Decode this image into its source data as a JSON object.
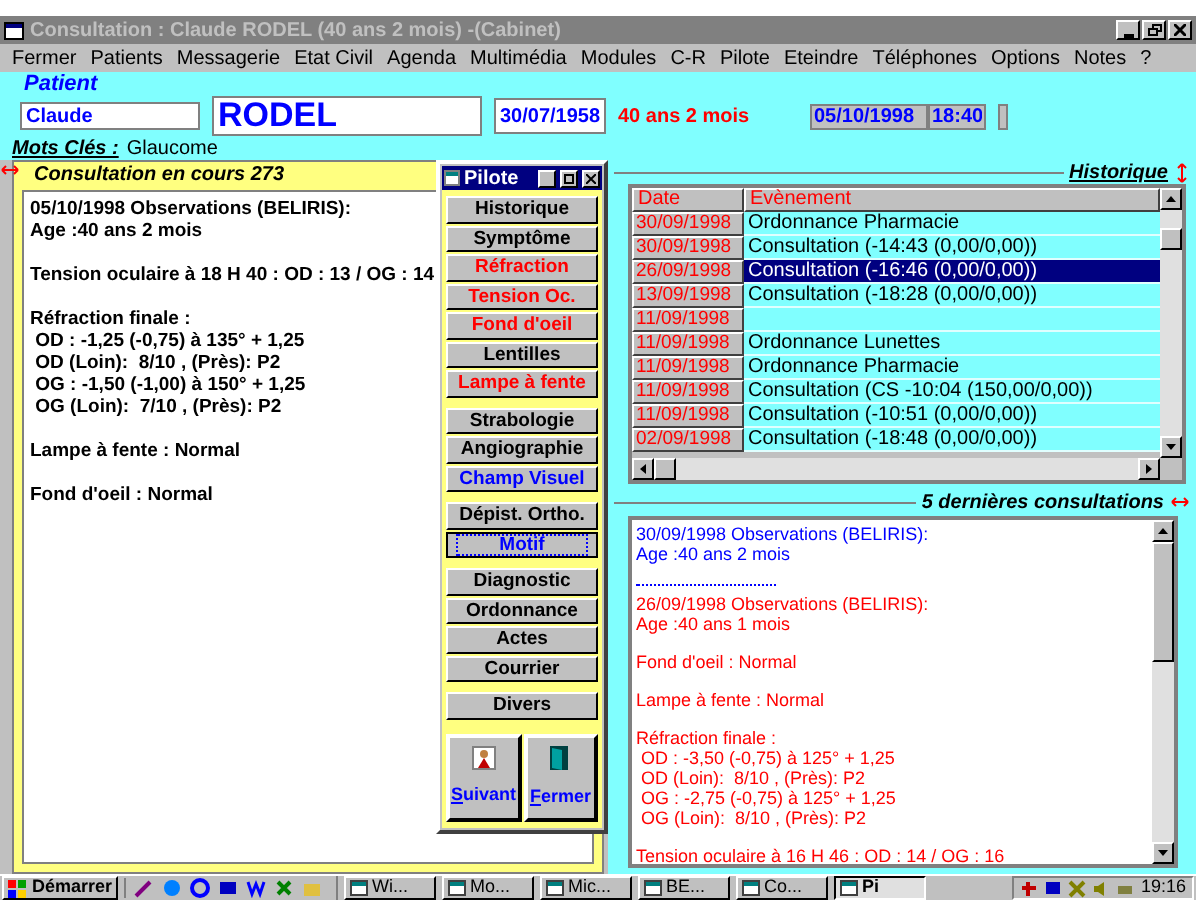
{
  "window": {
    "title": "Consultation : Claude RODEL (40 ans 2 mois)  -(Cabinet)"
  },
  "menu": [
    "Fermer",
    "Patients",
    "Messagerie",
    "Etat Civil",
    "Agenda",
    "Multimédia",
    "Modules",
    "C-R",
    "Pilote",
    "Eteindre",
    "Téléphones",
    "Options",
    "Notes",
    "?"
  ],
  "patient": {
    "label": "Patient",
    "first_name": "Claude",
    "last_name": "RODEL",
    "birth_date": "30/07/1958",
    "age": "40 ans 2 mois",
    "date": "05/10/1998",
    "time": "18:40",
    "keywords_label": "Mots Clés :",
    "keywords": "Glaucome"
  },
  "consultation": {
    "title": "Consultation en cours 273",
    "paragraphs": [
      [
        "05/10/1998 Observations (BELIRIS):",
        "Age :40 ans 2 mois"
      ],
      [
        "Tension oculaire à 18 H 40 : OD : 13 / OG : 14"
      ],
      [
        "Réfraction finale :",
        " OD : -1,25 (-0,75) à 135° + 1,25",
        " OD (Loin):  8/10 , (Près): P2",
        " OG : -1,50 (-1,00) à 150° + 1,25",
        " OG (Loin):  7/10 , (Près): P2"
      ],
      [
        "Lampe à fente : Normal"
      ],
      [
        "Fond d'oeil : Normal"
      ]
    ]
  },
  "pilote": {
    "title": "Pilote",
    "groups": [
      [
        {
          "label": "Historique",
          "color": "#000000",
          "focused": false
        },
        {
          "label": "Symptôme",
          "color": "#000000",
          "focused": false
        },
        {
          "label": "Réfraction",
          "color": "#ff0000",
          "focused": false
        },
        {
          "label": "Tension Oc.",
          "color": "#ff0000",
          "focused": false
        },
        {
          "label": "Fond d'oeil",
          "color": "#ff0000",
          "focused": false
        },
        {
          "label": "Lentilles",
          "color": "#000000",
          "focused": false
        },
        {
          "label": "Lampe à fente",
          "color": "#ff0000",
          "focused": false
        }
      ],
      [
        {
          "label": "Strabologie",
          "color": "#000000",
          "focused": false
        },
        {
          "label": "Angiographie",
          "color": "#000000",
          "focused": false
        },
        {
          "label": "Champ Visuel",
          "color": "#0000ff",
          "focused": false
        }
      ],
      [
        {
          "label": "Dépist. Ortho.",
          "color": "#000000",
          "focused": false
        },
        {
          "label": "Motif",
          "color": "#0000ff",
          "focused": true
        }
      ],
      [
        {
          "label": "Diagnostic",
          "color": "#000000",
          "focused": false
        },
        {
          "label": "Ordonnance",
          "color": "#000000",
          "focused": false
        },
        {
          "label": "Actes",
          "color": "#000000",
          "focused": false
        },
        {
          "label": "Courrier",
          "color": "#000000",
          "focused": false
        }
      ],
      [
        {
          "label": "Divers",
          "color": "#000000",
          "focused": false
        }
      ]
    ],
    "actions": [
      {
        "label": "Suivant",
        "kind": "next"
      },
      {
        "label": "Fermer",
        "kind": "exit"
      }
    ]
  },
  "historique": {
    "title": "Historique",
    "columns": [
      "Date",
      "Evènement"
    ],
    "rows": [
      {
        "date": "30/09/1998",
        "event": "Ordonnance Pharmacie",
        "selected": false
      },
      {
        "date": "30/09/1998",
        "event": "Consultation (-14:43 (0,00/0,00))",
        "selected": false
      },
      {
        "date": "26/09/1998",
        "event": "Consultation (-16:46 (0,00/0,00))",
        "selected": true
      },
      {
        "date": "13/09/1998",
        "event": "Consultation (-18:28 (0,00/0,00))",
        "selected": false
      },
      {
        "date": "11/09/1998",
        "selected": false
      },
      {
        "date": "11/09/1998",
        "event": "Ordonnance Lunettes",
        "selected": false
      },
      {
        "date": "11/09/1998",
        "event": "Ordonnance Pharmacie",
        "selected": false
      },
      {
        "date": "11/09/1998",
        "event": "Consultation (CS -10:04 (150,00/0,00))",
        "selected": false
      },
      {
        "date": "11/09/1998",
        "event": "Consultation (-10:51 (0,00/0,00))",
        "selected": false
      },
      {
        "date": "02/09/1998",
        "event": "Consultation (-18:48 (0,00/0,00))",
        "selected": false
      }
    ]
  },
  "recent": {
    "title": "5 dernières consultations",
    "entries": [
      {
        "color": "#0000ff",
        "paragraphs": [
          [
            "30/09/1998 Observations (BELIRIS):",
            "Age :40 ans 2 mois"
          ]
        ]
      },
      {
        "color": "#ff0000",
        "paragraphs": [
          [
            "26/09/1998 Observations (BELIRIS):",
            "Age :40 ans 1 mois"
          ],
          [
            "Fond d'oeil : Normal"
          ],
          [
            "Lampe à fente : Normal"
          ],
          [
            "Réfraction finale :",
            " OD : -3,50 (-0,75) à 125° + 1,25",
            " OD (Loin):  8/10 , (Près): P2",
            " OG : -2,75 (-0,75) à 125° + 1,25",
            " OG (Loin):  8/10 , (Près): P2"
          ],
          [
            "Tension oculaire à 16 H 46 : OD : 14 / OG : 16"
          ]
        ]
      }
    ]
  },
  "taskbar": {
    "start": "Démarrer",
    "tasks": [
      {
        "label": "Wi...",
        "selected": false
      },
      {
        "label": "Mo...",
        "selected": false
      },
      {
        "label": "Mic...",
        "selected": false
      },
      {
        "label": "BE...",
        "selected": false
      },
      {
        "label": "Co...",
        "selected": false
      },
      {
        "label": "Pi",
        "selected": true
      }
    ],
    "clock": "19:16"
  }
}
